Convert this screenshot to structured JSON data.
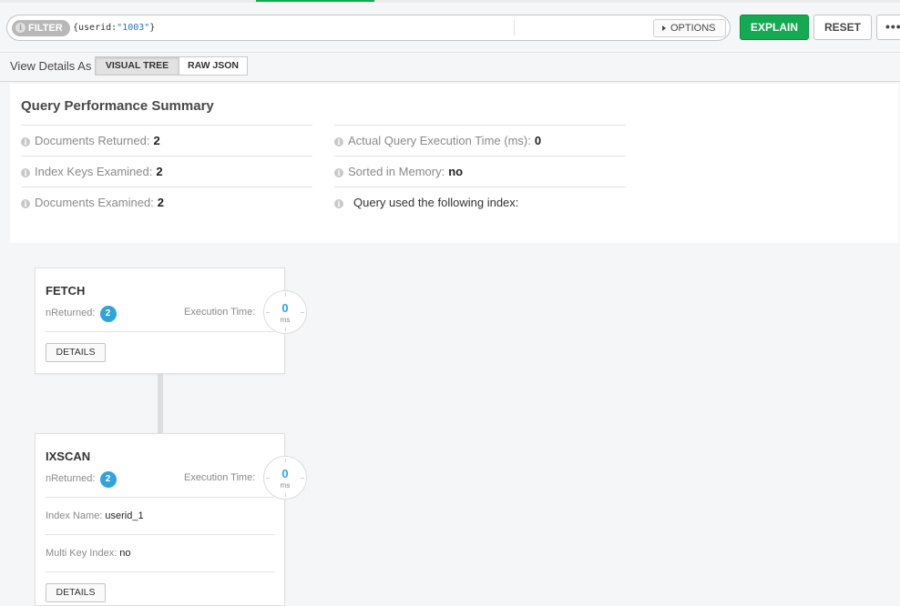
{
  "filter": {
    "pill_label": "FILTER",
    "query_prefix": "{userid:",
    "query_value": "\"1003\"",
    "query_suffix": "}",
    "options_label": "OPTIONS"
  },
  "actions": {
    "explain_label": "EXPLAIN",
    "reset_label": "RESET",
    "more_label": "•••"
  },
  "view": {
    "label": "View Details As",
    "visual_tree_label": "VISUAL TREE",
    "raw_json_label": "RAW JSON"
  },
  "summary": {
    "title": "Query Performance Summary",
    "docs_returned_label": "Documents Returned:",
    "docs_returned_value": "2",
    "keys_examined_label": "Index Keys Examined:",
    "keys_examined_value": "2",
    "docs_examined_label": "Documents Examined:",
    "docs_examined_value": "2",
    "exec_time_label": "Actual Query Execution Time (ms):",
    "exec_time_value": "0",
    "sorted_label": "Sorted in Memory:",
    "sorted_value": "no",
    "index_label": "Query used the following index:"
  },
  "stages": {
    "fetch": {
      "name": "FETCH",
      "nreturned_label": "nReturned:",
      "nreturned_value": "2",
      "exec_label": "Execution Time:",
      "exec_value": "0",
      "exec_unit": "ms",
      "details_label": "DETAILS"
    },
    "ixscan": {
      "name": "IXSCAN",
      "nreturned_label": "nReturned:",
      "nreturned_value": "2",
      "exec_label": "Execution Time:",
      "exec_value": "0",
      "exec_unit": "ms",
      "index_name_label": "Index Name:",
      "index_name_value": "userid_1",
      "multikey_label": "Multi Key Index:",
      "multikey_value": "no",
      "details_label": "DETAILS"
    }
  },
  "colors": {
    "accent_green": "#13aa52",
    "badge_blue": "#2ea3dc"
  }
}
